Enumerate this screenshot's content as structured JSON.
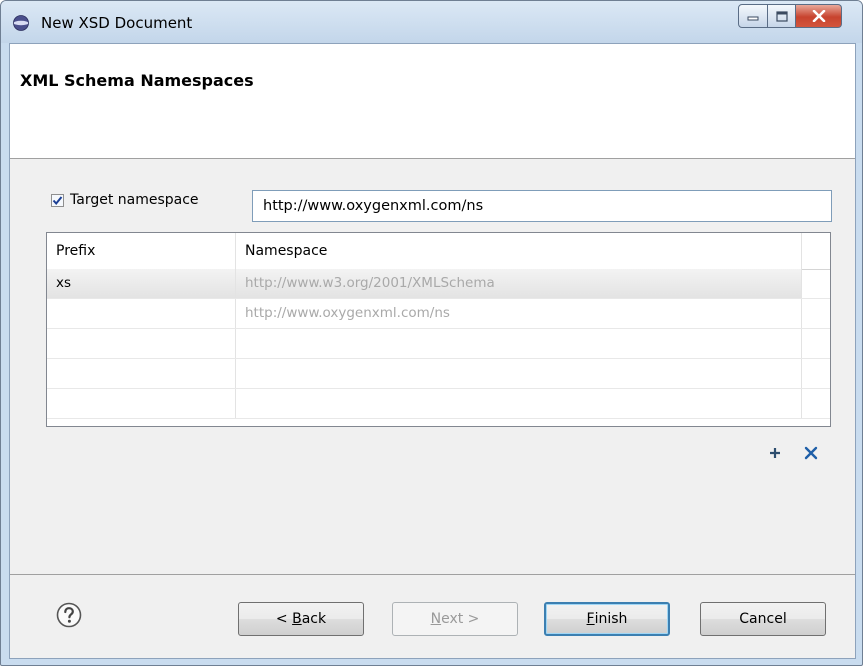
{
  "window": {
    "title": "New XSD Document",
    "app_icon": "oxygen-app-icon",
    "controls": [
      "minimize-icon",
      "maximize-icon",
      "close-icon"
    ]
  },
  "header": {
    "title": "XML Schema Namespaces"
  },
  "target_namespace": {
    "checked": true,
    "label": "Target namespace",
    "value": "http://www.oxygenxml.com/ns"
  },
  "table": {
    "columns": [
      "Prefix",
      "Namespace"
    ],
    "rows": [
      {
        "prefix": "xs",
        "namespace": "http://www.w3.org/2001/XMLSchema",
        "selected": true
      },
      {
        "prefix": "",
        "namespace": "http://www.oxygenxml.com/ns",
        "selected": false
      },
      {
        "prefix": "",
        "namespace": "",
        "selected": false
      },
      {
        "prefix": "",
        "namespace": "",
        "selected": false
      },
      {
        "prefix": "",
        "namespace": "",
        "selected": false
      }
    ]
  },
  "table_actions": {
    "add_icon": "plus-icon",
    "remove_icon": "x-delete-icon",
    "accent_color": "#1f5fa8"
  },
  "footer": {
    "help_icon": "question-circle-icon",
    "back": {
      "pre": "< ",
      "mnemonic": "B",
      "post": "ack"
    },
    "next": {
      "mnemonic": "N",
      "post": "ext >"
    },
    "finish": {
      "mnemonic": "F",
      "post": "inish"
    },
    "cancel": "Cancel"
  }
}
